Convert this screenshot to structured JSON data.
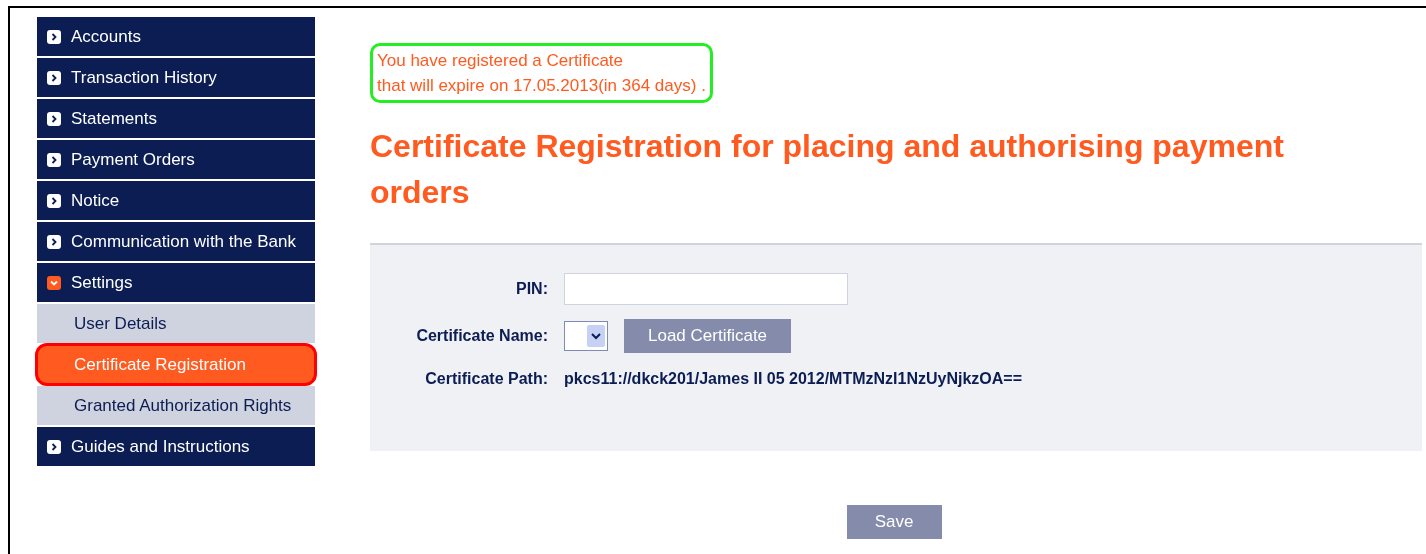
{
  "sidebar": {
    "items": [
      {
        "label": "Accounts",
        "expanded": false
      },
      {
        "label": "Transaction History",
        "expanded": false
      },
      {
        "label": "Statements",
        "expanded": false
      },
      {
        "label": "Payment Orders",
        "expanded": false
      },
      {
        "label": "Notice",
        "expanded": false
      },
      {
        "label": "Communication with the Bank",
        "expanded": false
      },
      {
        "label": "Settings",
        "expanded": true,
        "children": [
          {
            "label": "User Details",
            "selected": false,
            "highlighted": false
          },
          {
            "label": "Certificate Registration",
            "selected": true,
            "highlighted": true
          },
          {
            "label": "Granted Authorization Rights",
            "selected": false,
            "highlighted": false
          }
        ]
      },
      {
        "label": "Guides and Instructions",
        "expanded": false
      }
    ]
  },
  "notice": {
    "lines": [
      "You have registered a Certificate",
      "that will expire on 17.05.2013(in 364 days) ."
    ],
    "highlighted": true
  },
  "heading": "Certificate Registration for placing and authorising payment orders",
  "form": {
    "pin_label": "PIN:",
    "certificate_name_label": "Certificate Name:",
    "load_button": "Load Certificate",
    "certificate_path_label": "Certificate Path:",
    "certificate_path": "pkcs11://dkck201/James II 05 2012/MTMzNzI1NzUyNjkzOA=="
  },
  "save_button": "Save"
}
